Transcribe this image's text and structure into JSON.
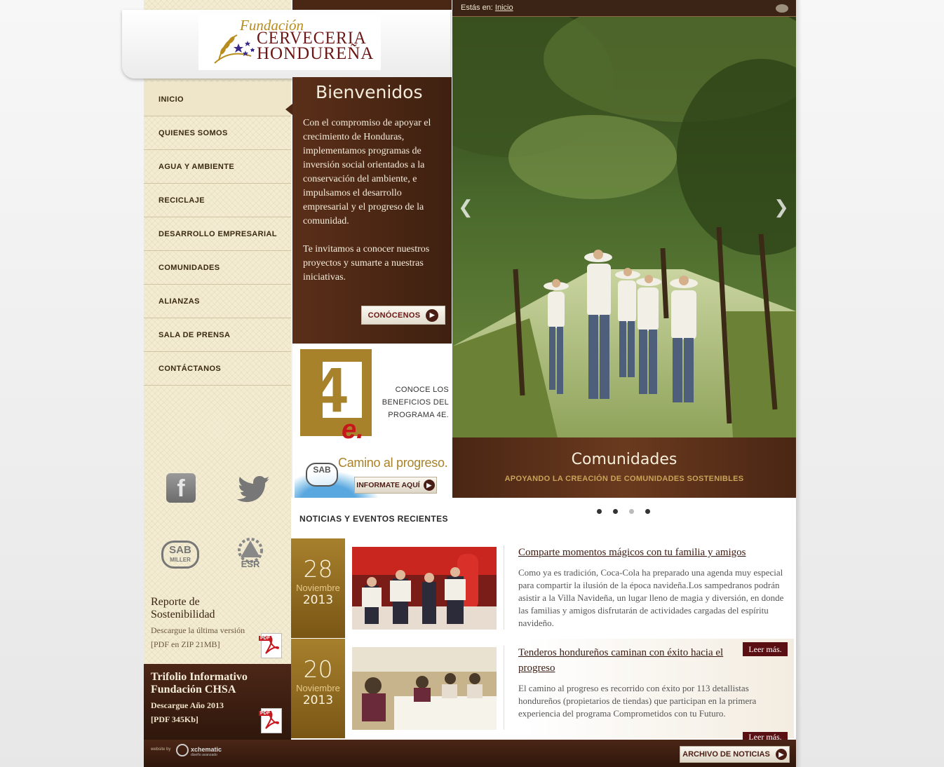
{
  "logo": {
    "fundacion": "Fundación",
    "line1": "CERVECERIA",
    "line2": "HONDUREÑA"
  },
  "breadcrumb": {
    "label": "Estás en:",
    "link": "Inicio"
  },
  "nav": {
    "items": [
      {
        "label": "INICIO"
      },
      {
        "label": "QUIENES SOMOS"
      },
      {
        "label": "AGUA Y AMBIENTE"
      },
      {
        "label": "RECICLAJE"
      },
      {
        "label": "DESARROLLO EMPRESARIAL"
      },
      {
        "label": "COMUNIDADES"
      },
      {
        "label": "ALIANZAS"
      },
      {
        "label": "SALA DE PRENSA"
      },
      {
        "label": "CONTÁCTANOS"
      }
    ]
  },
  "welcome": {
    "title": "Bienvenidos",
    "p1": "Con el compromiso de apoyar el crecimiento de Honduras, implementamos programas de inversión social orientados a la conservación del ambiente, e impulsamos el desarrollo empresarial y el progreso de la comunidad.",
    "p2": "Te invitamos a conocer nuestros proyectos y sumarte a nuestras iniciativas.",
    "button": "CONÓCENOS"
  },
  "promo4e": {
    "number": "4",
    "letter": "e.",
    "text": "CONOCE LOS BENEFICIOS DEL PROGRAMA 4E.",
    "camino": "Camino al progreso.",
    "sab": "SAB",
    "button": "INFORMATE AQUÍ"
  },
  "hero": {
    "title": "Comunidades",
    "subtitle": "APOYANDO LA CREACIÓN DE COMUNIDADES SOSTENIBLES",
    "active_slide": 3,
    "slides": 4
  },
  "news": {
    "heading": "NOTICIAS Y EVENTOS RECIENTES",
    "items": [
      {
        "day": "28",
        "month": "Noviembre",
        "year": "2013",
        "title": "Comparte momentos mágicos con tu familia y amigos",
        "body": "Como ya es tradición, Coca-Cola ha preparado una agenda muy especial para compartir la ilusión de la época navideña.Los sampedranos podrán asistir a la Villa Navideña, un lugar lleno de magia y diversión, en donde las familias y amigos disfrutarán de actividades cargadas del espíritu navideño.",
        "more": "Leer más."
      },
      {
        "day": "20",
        "month": "Noviembre",
        "year": "2013",
        "title": "Tenderos hondureños caminan con éxito hacia el progreso",
        "body": "El camino al progreso es recorrido con éxito por 113 detallistas hondureños (propietarios de tiendas) que participan en la primera experiencia del programa Comprometidos con tu Futuro.",
        "more": "Leer más."
      }
    ],
    "archive_button": "ARCHIVO DE NOTICIAS"
  },
  "social": {
    "facebook": "f",
    "sab_top": "SAB",
    "sab_bottom": "MILLER",
    "esr": "ESR"
  },
  "report": {
    "title": "Reporte de Sostenibilidad",
    "sub1": "Descargue la última versión",
    "sub2": "[PDF en ZIP 21MB]"
  },
  "trifolio": {
    "title": "Trifolio Informativo Fundación CHSA",
    "sub1": "Descargue Año 2013",
    "sub2": "[PDF 345Kb]"
  },
  "pdf_tag": "PDF",
  "footer": {
    "web": "website by",
    "brand": "xchematic",
    "tagline": "diseño avanzado"
  }
}
